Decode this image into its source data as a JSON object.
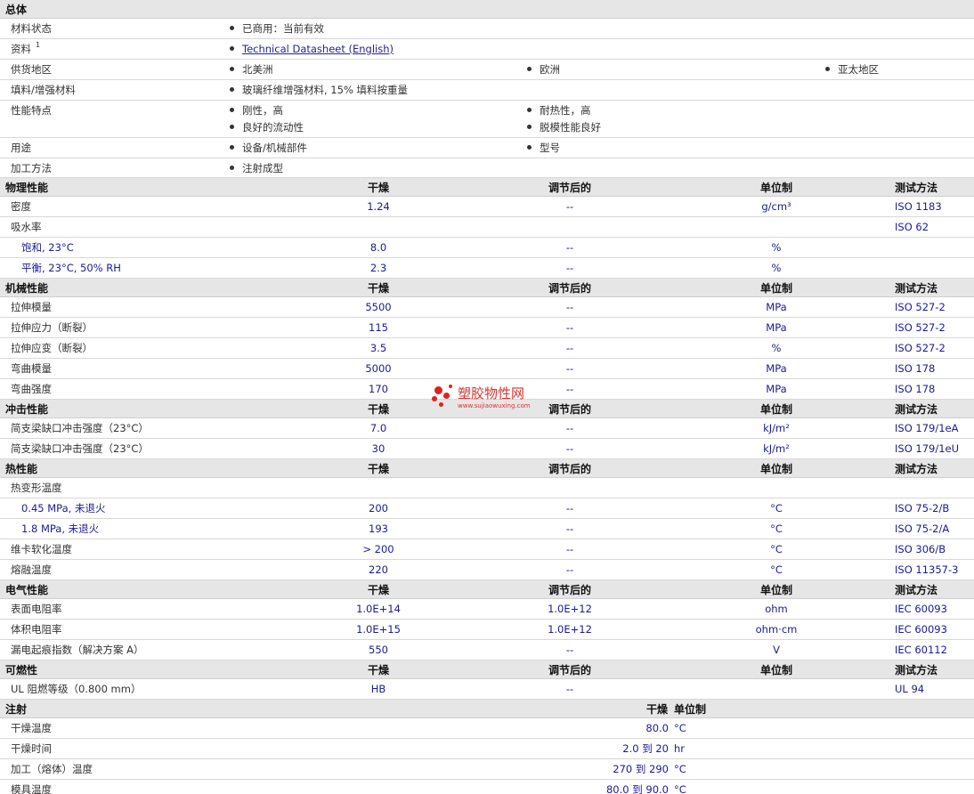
{
  "general": {
    "title": "总体",
    "status": {
      "label": "材料状态",
      "value": "已商用：当前有效"
    },
    "docs": {
      "label": "资料",
      "sup": "1",
      "link": "Technical Datasheet (English)"
    },
    "supply": {
      "label": "供货地区",
      "values": [
        "北美洲",
        "欧洲",
        "亚太地区"
      ]
    },
    "filler": {
      "label": "填料/增强材料",
      "value": "玻璃纤维增强材料, 15% 填料按重量"
    },
    "features": {
      "label": "性能特点",
      "values": [
        "刚性，高",
        "耐热性，高",
        "良好的流动性",
        "脱模性能良好"
      ]
    },
    "uses": {
      "label": "用途",
      "values": [
        "设备/机械部件",
        "型号"
      ]
    },
    "processing": {
      "label": "加工方法",
      "value": "注射成型"
    }
  },
  "columns": {
    "dry": "干燥",
    "cond": "调节后的",
    "unit": "单位制",
    "method": "测试方法"
  },
  "physical": {
    "title": "物理性能",
    "rows": [
      {
        "name": "密度",
        "dry": "1.24",
        "cond": "--",
        "unit": "g/cm³",
        "method": "ISO 1183"
      },
      {
        "name": "吸水率",
        "dry": "",
        "cond": "",
        "unit": "",
        "method": "ISO 62"
      },
      {
        "name": "饱和, 23°C",
        "dry": "8.0",
        "cond": "--",
        "unit": "%",
        "method": ""
      },
      {
        "name": "平衡, 23°C, 50% RH",
        "dry": "2.3",
        "cond": "--",
        "unit": "%",
        "method": ""
      }
    ]
  },
  "mechanical": {
    "title": "机械性能",
    "rows": [
      {
        "name": "拉伸模量",
        "dry": "5500",
        "cond": "--",
        "unit": "MPa",
        "method": "ISO 527-2"
      },
      {
        "name": "拉伸应力（断裂）",
        "dry": "115",
        "cond": "--",
        "unit": "MPa",
        "method": "ISO 527-2"
      },
      {
        "name": "拉伸应变（断裂）",
        "dry": "3.5",
        "cond": "--",
        "unit": "%",
        "method": "ISO 527-2"
      },
      {
        "name": "弯曲模量",
        "dry": "5000",
        "cond": "--",
        "unit": "MPa",
        "method": "ISO 178"
      },
      {
        "name": "弯曲强度",
        "dry": "170",
        "cond": "--",
        "unit": "MPa",
        "method": "ISO 178"
      }
    ]
  },
  "impact": {
    "title": "冲击性能",
    "rows": [
      {
        "name": "简支梁缺口冲击强度（23°C）",
        "dry": "7.0",
        "cond": "--",
        "unit": "kJ/m²",
        "method": "ISO 179/1eA"
      },
      {
        "name": "简支梁缺口冲击强度（23°C）",
        "dry": "30",
        "cond": "--",
        "unit": "kJ/m²",
        "method": "ISO 179/1eU"
      }
    ]
  },
  "thermal": {
    "title": "热性能",
    "rows": [
      {
        "name": "热变形温度",
        "dry": "",
        "cond": "",
        "unit": "",
        "method": ""
      },
      {
        "name": "0.45 MPa, 未退火",
        "dry": "200",
        "cond": "--",
        "unit": "°C",
        "method": "ISO 75-2/B"
      },
      {
        "name": "1.8 MPa, 未退火",
        "dry": "193",
        "cond": "--",
        "unit": "°C",
        "method": "ISO 75-2/A"
      },
      {
        "name": "维卡软化温度",
        "dry": "> 200",
        "cond": "--",
        "unit": "°C",
        "method": "ISO 306/B"
      },
      {
        "name": "熔融温度",
        "dry": "220",
        "cond": "--",
        "unit": "°C",
        "method": "ISO 11357-3"
      }
    ]
  },
  "electrical": {
    "title": "电气性能",
    "rows": [
      {
        "name": "表面电阻率",
        "dry": "1.0E+14",
        "cond": "1.0E+12",
        "unit": "ohm",
        "method": "IEC 60093"
      },
      {
        "name": "体积电阻率",
        "dry": "1.0E+15",
        "cond": "1.0E+12",
        "unit": "ohm·cm",
        "method": "IEC 60093"
      },
      {
        "name": "漏电起痕指数（解决方案 A）",
        "dry": "550",
        "cond": "--",
        "unit": "V",
        "method": "IEC 60112"
      }
    ]
  },
  "flammability": {
    "title": "可燃性",
    "rows": [
      {
        "name": "UL 阻燃等级（0.800 mm）",
        "dry": "HB",
        "cond": "--",
        "unit": "",
        "method": "UL 94"
      }
    ]
  },
  "injection": {
    "title": "注射",
    "dry": "干燥",
    "unit": "单位制",
    "rows": [
      {
        "name": "干燥温度",
        "value": "80.0",
        "unit": "°C"
      },
      {
        "name": "干燥时间",
        "value": "2.0 到 20",
        "unit": "hr"
      },
      {
        "name": "加工（熔体）温度",
        "value": "270 到 290",
        "unit": "°C"
      },
      {
        "name": "模具温度",
        "value": "80.0 到 90.0",
        "unit": "°C"
      }
    ]
  },
  "watermark": {
    "text": "塑胶物性网",
    "url": "www.sujiaowuxing.com"
  }
}
